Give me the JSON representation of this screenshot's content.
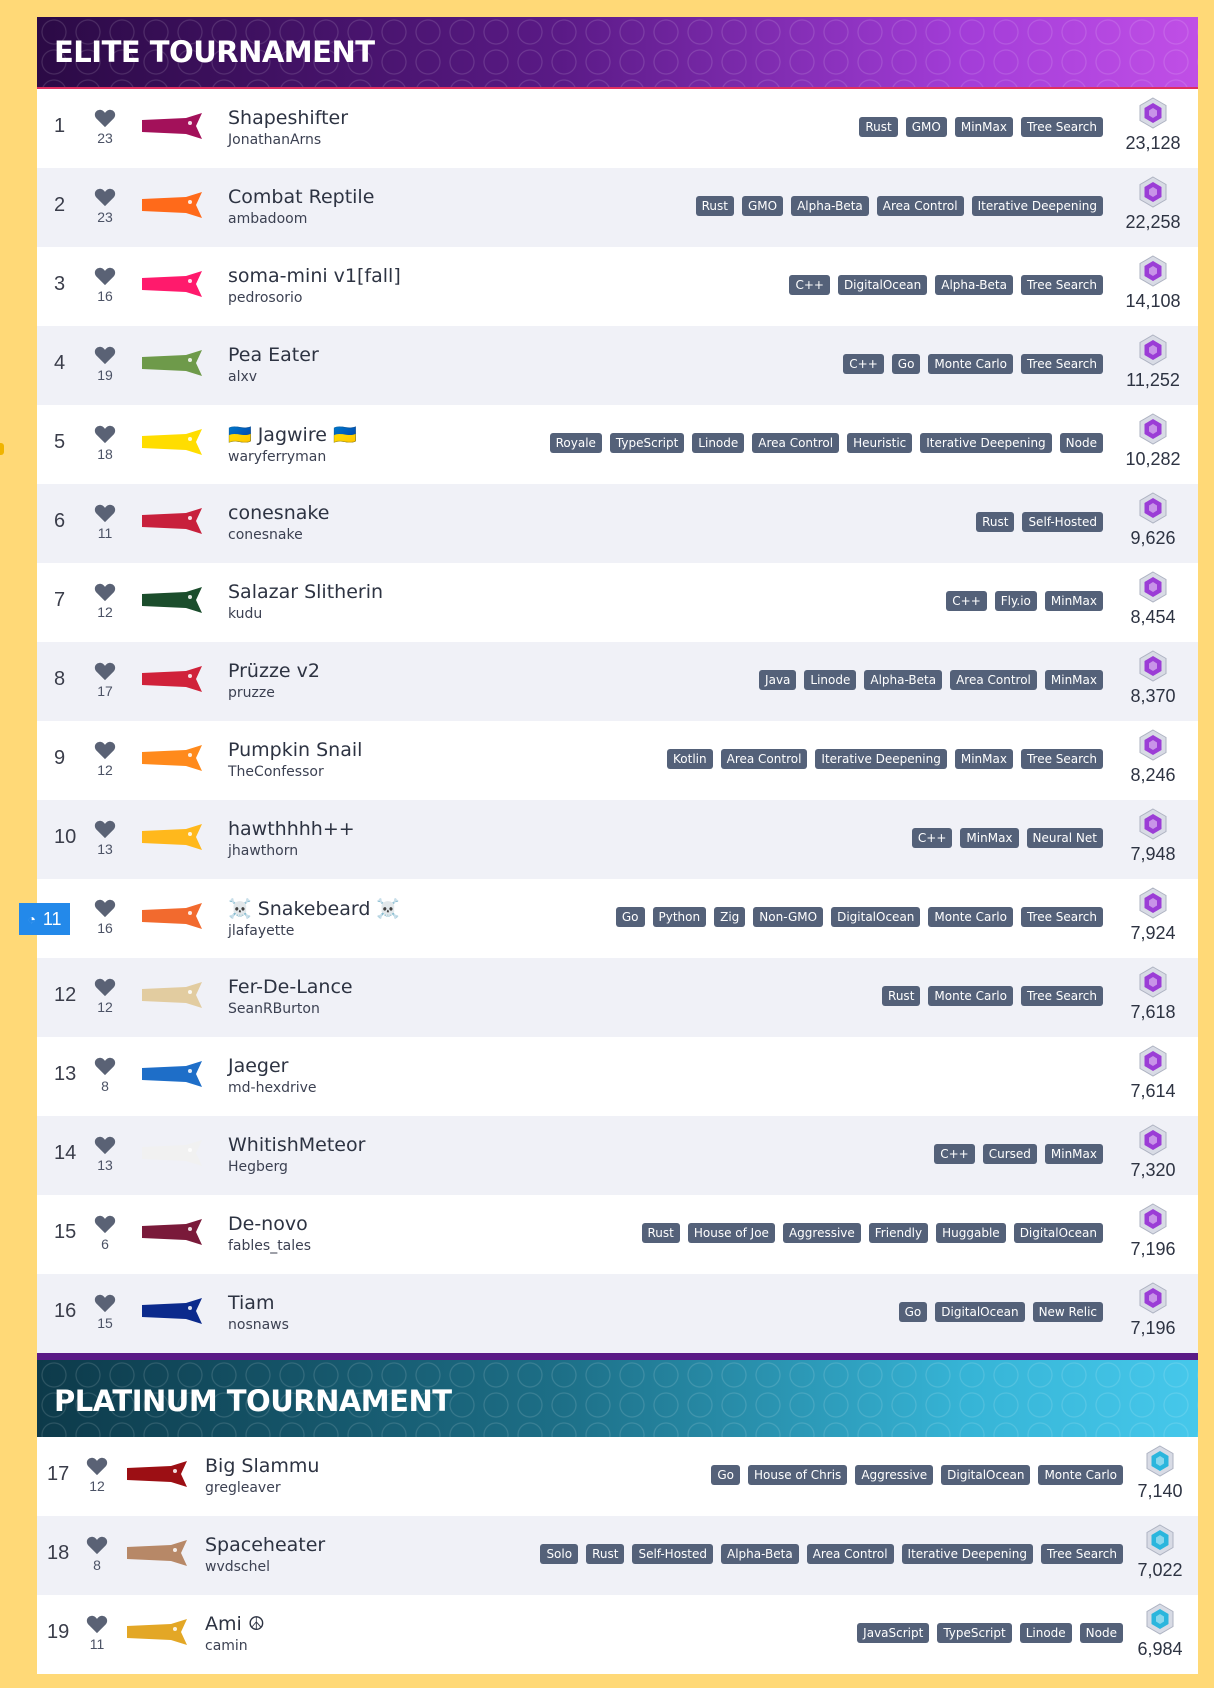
{
  "elite": {
    "title": "ELITE TOURNAMENT",
    "rows": [
      {
        "rank": "1",
        "likes": "23",
        "name": "Shapeshifter",
        "author": "JonathanArns",
        "color": "#a3115a",
        "tags": [
          "Rust",
          "GMO",
          "MinMax",
          "Tree Search"
        ],
        "score": "23,128"
      },
      {
        "rank": "2",
        "likes": "23",
        "name": "Combat Reptile",
        "author": "ambadoom",
        "color": "#ff6a1a",
        "tags": [
          "Rust",
          "GMO",
          "Alpha-Beta",
          "Area Control",
          "Iterative Deepening"
        ],
        "score": "22,258"
      },
      {
        "rank": "3",
        "likes": "16",
        "name": "soma-mini v1[fall]",
        "author": "pedrosorio",
        "color": "#ff1a6c",
        "tags": [
          "C++",
          "DigitalOcean",
          "Alpha-Beta",
          "Tree Search"
        ],
        "score": "14,108"
      },
      {
        "rank": "4",
        "likes": "19",
        "name": "Pea Eater",
        "author": "alxv",
        "color": "#6e9a4a",
        "tags": [
          "C++",
          "Go",
          "Monte Carlo",
          "Tree Search"
        ],
        "score": "11,252"
      },
      {
        "rank": "5",
        "likes": "18",
        "name": "🇺🇦 Jagwire 🇺🇦",
        "author": "waryferryman",
        "color": "#ffdd00",
        "tags": [
          "Royale",
          "TypeScript",
          "Linode",
          "Area Control",
          "Heuristic",
          "Iterative Deepening",
          "Node"
        ],
        "score": "10,282"
      },
      {
        "rank": "6",
        "likes": "11",
        "name": "conesnake",
        "author": "conesnake",
        "color": "#c8203c",
        "tags": [
          "Rust",
          "Self-Hosted"
        ],
        "score": "9,626"
      },
      {
        "rank": "7",
        "likes": "12",
        "name": "Salazar Slitherin",
        "author": "kudu",
        "color": "#1b4d2c",
        "tags": [
          "C++",
          "Fly.io",
          "MinMax"
        ],
        "score": "8,454"
      },
      {
        "rank": "8",
        "likes": "17",
        "name": "Prüzze v2",
        "author": "pruzze",
        "color": "#d0223a",
        "tags": [
          "Java",
          "Linode",
          "Alpha-Beta",
          "Area Control",
          "MinMax"
        ],
        "score": "8,370"
      },
      {
        "rank": "9",
        "likes": "12",
        "name": "Pumpkin Snail",
        "author": "TheConfessor",
        "color": "#ff8a1c",
        "tags": [
          "Kotlin",
          "Area Control",
          "Iterative Deepening",
          "MinMax",
          "Tree Search"
        ],
        "score": "8,246"
      },
      {
        "rank": "10",
        "likes": "13",
        "name": "hawthhhh++",
        "author": "jhawthorn",
        "color": "#ffb81c",
        "tags": [
          "C++",
          "MinMax",
          "Neural Net"
        ],
        "score": "7,948"
      },
      {
        "rank": "11",
        "likes": "16",
        "name": "☠️ Snakebeard ☠️",
        "author": "jlafayette",
        "color": "#f26a2e",
        "tags": [
          "Go",
          "Python",
          "Zig",
          "Non-GMO",
          "DigitalOcean",
          "Monte Carlo",
          "Tree Search"
        ],
        "score": "7,924",
        "sponsor_label": "DigitalOcean"
      },
      {
        "rank": "12",
        "likes": "12",
        "name": "Fer-De-Lance",
        "author": "SeanRBurton",
        "color": "#e2cca0",
        "tags": [
          "Rust",
          "Monte Carlo",
          "Tree Search"
        ],
        "score": "7,618"
      },
      {
        "rank": "13",
        "likes": "8",
        "name": "Jaeger",
        "author": "md-hexdrive",
        "color": "#1e6ec8",
        "tags": [],
        "score": "7,614"
      },
      {
        "rank": "14",
        "likes": "13",
        "name": "WhitishMeteor",
        "author": "Hegberg",
        "color": "#f1f1f1",
        "tags": [
          "C++",
          "Cursed",
          "MinMax"
        ],
        "score": "7,320"
      },
      {
        "rank": "15",
        "likes": "6",
        "name": "De-novo",
        "author": "fables_tales",
        "color": "#7a1a3a",
        "tags": [
          "Rust",
          "House of Joe",
          "Aggressive",
          "Friendly",
          "Huggable",
          "DigitalOcean"
        ],
        "score": "7,196"
      },
      {
        "rank": "16",
        "likes": "15",
        "name": "Tiam",
        "author": "nosnaws",
        "color": "#0b2a8c",
        "tags": [
          "Go",
          "DigitalOcean",
          "New Relic"
        ],
        "score": "7,196"
      }
    ]
  },
  "platinum": {
    "title": "PLATINUM TOURNAMENT",
    "rows": [
      {
        "rank": "17",
        "likes": "12",
        "name": "Big Slammu",
        "author": "gregleaver",
        "color": "#9c0f14",
        "tags": [
          "Go",
          "House of Chris",
          "Aggressive",
          "DigitalOcean",
          "Monte Carlo"
        ],
        "score": "7,140"
      },
      {
        "rank": "18",
        "likes": "8",
        "name": "Spaceheater",
        "author": "wvdschel",
        "color": "#b78867",
        "tags": [
          "Solo",
          "Rust",
          "Self-Hosted",
          "Alpha-Beta",
          "Area Control",
          "Iterative Deepening",
          "Tree Search"
        ],
        "score": "7,022"
      },
      {
        "rank": "19",
        "likes": "11",
        "name": "Ami ☮",
        "author": "camin",
        "color": "#e3a726",
        "tags": [
          "JavaScript",
          "TypeScript",
          "Linode",
          "Node"
        ],
        "score": "6,984"
      }
    ]
  },
  "colors": {
    "elite_gem": "#9b3dd6",
    "platinum_gem": "#2bb6dd",
    "tag_bg": "#546179",
    "page_bg": "#ffd977"
  }
}
